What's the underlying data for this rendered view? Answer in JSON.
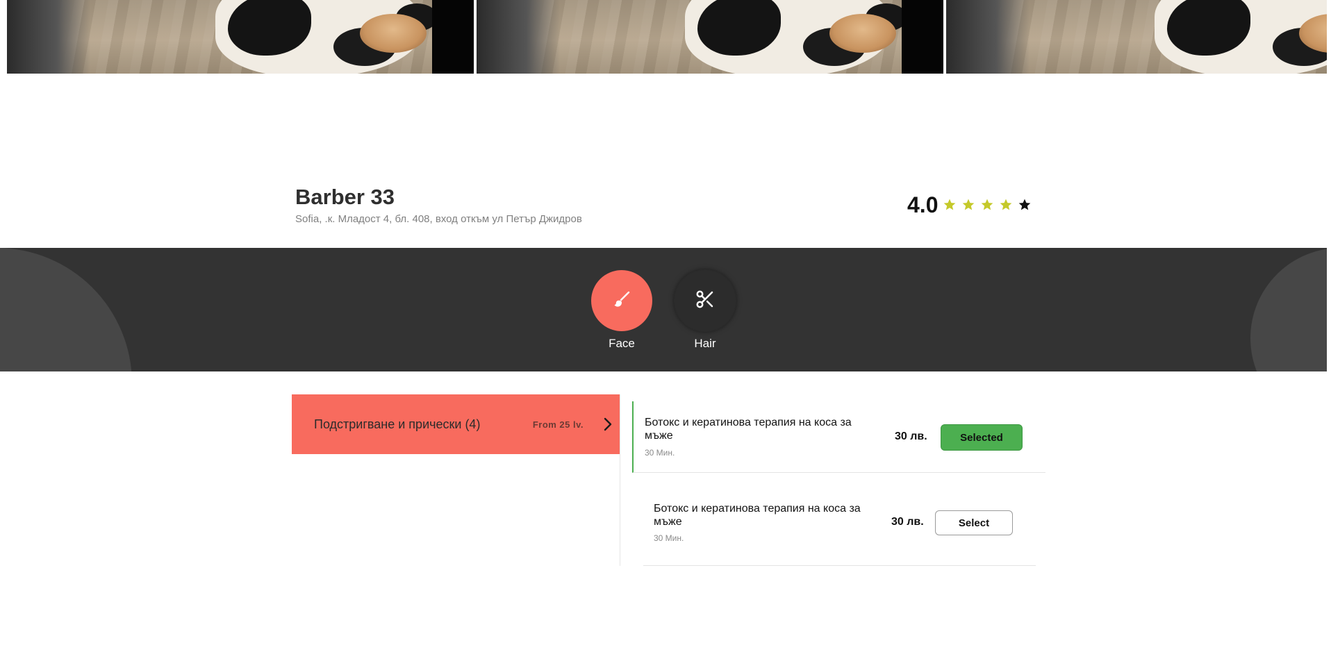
{
  "gallery": {
    "photos": [
      "barbershop-photo",
      "barbershop-photo",
      "barbershop-photo"
    ]
  },
  "shop": {
    "name": "Barber 33",
    "address": "Sofia, .к. Младост 4, бл. 408, вход откъм ул Петър Джидров",
    "rating": "4.0",
    "stars": [
      {
        "icon": "star-icon",
        "color": "#c5c92a"
      },
      {
        "icon": "star-icon",
        "color": "#c5c92a"
      },
      {
        "icon": "star-icon",
        "color": "#c5c92a"
      },
      {
        "icon": "star-icon",
        "color": "#c5c92a"
      },
      {
        "icon": "star-icon",
        "color": "#111111"
      }
    ]
  },
  "categories": [
    {
      "label": "Face",
      "icon": "brush-icon",
      "active": true,
      "color": "#f86b5e"
    },
    {
      "label": "Hair",
      "icon": "scissors-icon",
      "active": false,
      "color": "#2c2c2c"
    }
  ],
  "service_group": {
    "label": "Подстригване и прически (4)",
    "from": "From 25 lv.",
    "icon": "chevron-right-icon",
    "color": "#f86b5e"
  },
  "services": [
    {
      "name": "Ботокс и кератинова терапия на коса за мъже",
      "duration": "30 Мин.",
      "price": "30 лв.",
      "button": "Selected",
      "selected": true
    },
    {
      "name": "Ботокс и кератинова терапия на коса за мъже",
      "duration": "30 Мин.",
      "price": "30 лв.",
      "button": "Select",
      "selected": false
    }
  ],
  "colors": {
    "accent": "#f86b5e",
    "band": "#333333",
    "selected": "#4caf50"
  }
}
